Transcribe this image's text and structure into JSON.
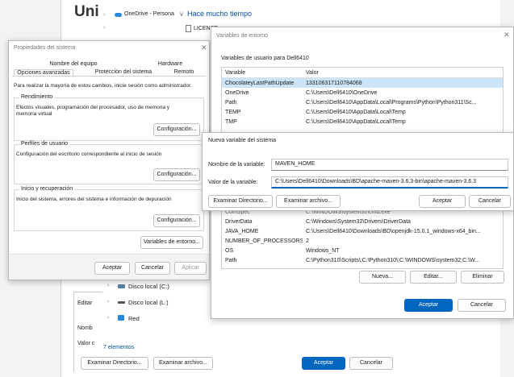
{
  "explorer": {
    "title_partial": "Uni",
    "breadcrumb_location": "OneDrive - Persona",
    "path_item": "Hace mucho tiempo",
    "file_partial": "LICENSE",
    "tree_items": [
      {
        "label": "Disco local (C:)"
      },
      {
        "label": "Disco local (L:)"
      },
      {
        "label": "Red"
      }
    ],
    "status": "7 elementos",
    "behind_labels": {
      "editar": "Editar",
      "nombre": "Nomb",
      "valor": "Valor c"
    },
    "behind_buttons": {
      "examinar_dir": "Examinar Directorio...",
      "examinar_arch": "Examinar archivo...",
      "aceptar": "Aceptar",
      "cancelar": "Cancelar"
    }
  },
  "system_props": {
    "title": "Propiedades del sistema",
    "tabs_row1": [
      "Nombre del equipo",
      "Hardware"
    ],
    "tabs_row2": [
      "Opciones avanzadas",
      "Protección del sistema",
      "Remoto"
    ],
    "admin_note": "Para realizar la mayoría de estos cambios, inicie sesión como administrador.",
    "performance": {
      "label": "Rendimiento",
      "desc": "Efectos visuales, programación del procesador, uso de memoria y memoria virtual",
      "button": "Configuración..."
    },
    "profiles": {
      "label": "Perfiles de usuario",
      "desc": "Configuración del escritorio correspondiente al inicio de sesión",
      "button": "Configuración..."
    },
    "startup": {
      "label": "Inicio y recuperación",
      "desc": "Inicio del sistema, errores del sistema e información de depuración",
      "button": "Configuración..."
    },
    "env_button": "Variables de entorno...",
    "buttons": {
      "ok": "Aceptar",
      "cancel": "Cancelar",
      "apply": "Aplicar"
    }
  },
  "env_vars": {
    "title": "Variables de entorno",
    "user_section": "Variables de usuario para Dell6410",
    "columns": [
      "Variable",
      "Valor"
    ],
    "user_rows": [
      {
        "var": "ChocolateyLastPathUpdate",
        "val": "133106317110784068"
      },
      {
        "var": "OneDrive",
        "val": "C:\\Users\\Dell6410\\OneDrive"
      },
      {
        "var": "Path",
        "val": "C:\\Users\\Dell6410\\AppData\\Local\\Programs\\Python\\Python311\\Sc..."
      },
      {
        "var": "TEMP",
        "val": "C:\\Users\\Dell6410\\AppData\\Local\\Temp"
      },
      {
        "var": "TMP",
        "val": "C:\\Users\\Dell6410\\AppData\\Local\\Temp"
      }
    ],
    "system_rows": [
      {
        "var": "ComSpec",
        "val": "C:\\WINDOWS\\system32\\cmd.exe"
      },
      {
        "var": "DriverData",
        "val": "C:\\Windows\\System32\\Drivers\\DriverData"
      },
      {
        "var": "JAVA_HOME",
        "val": "C:\\Users\\Dell6410\\Downloads\\BD\\openjdk-15.0.1_windows-x64_bin..."
      },
      {
        "var": "NUMBER_OF_PROCESSORS",
        "val": "2"
      },
      {
        "var": "OS",
        "val": "Windows_NT"
      },
      {
        "var": "Path",
        "val": "C:\\Python310\\Scripts\\;C:\\Python310\\;C:\\WINDOWS\\system32;C:\\W..."
      }
    ],
    "sys_buttons": {
      "new": "Nueva...",
      "edit": "Editar...",
      "delete": "Eliminar"
    },
    "buttons": {
      "ok": "Aceptar",
      "cancel": "Cancelar"
    }
  },
  "new_var": {
    "title": "Nueva variable del sistema",
    "name_label": "Nombre de la variable:",
    "name_value": "MAVEN_HOME",
    "value_label": "Valor de la variable:",
    "value_value": "C:\\Users\\Dell6410\\Downloads\\BD\\apache-maven-3.6.3-bin\\apache-maven-3.6.3",
    "buttons": {
      "browse_dir": "Examinar Directorio...",
      "browse_file": "Examinar archivo...",
      "ok": "Aceptar",
      "cancel": "Cancelar"
    }
  },
  "colors": {
    "accent": "#0067c0",
    "selection": "#cce4f7",
    "folder": "#2b88d8"
  }
}
